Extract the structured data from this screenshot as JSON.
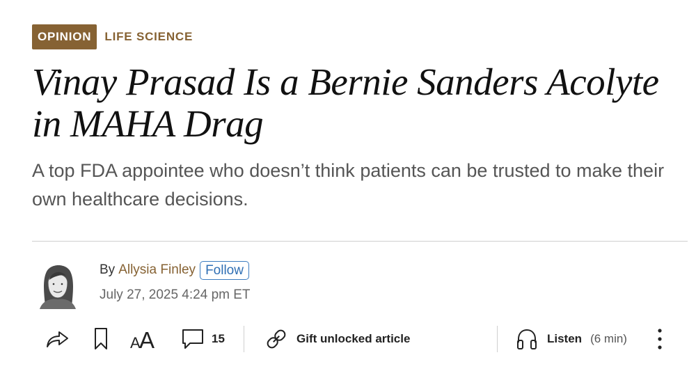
{
  "flags": {
    "opinion": "OPINION",
    "section": "LIFE SCIENCE"
  },
  "article": {
    "headline": "Vinay Prasad Is a Bernie Sanders Acolyte in MAHA Drag",
    "dek": "A top FDA appointee who doesn’t think patients can be trusted to make their own healthcare decisions."
  },
  "byline": {
    "prefix": "By",
    "author": "Allysia Finley",
    "follow_label": "Follow",
    "timestamp": "July 27, 2025 4:24 pm ET"
  },
  "toolbar": {
    "share_icon": "share-icon",
    "bookmark_icon": "bookmark-icon",
    "text_size_icon": "text-size-icon",
    "text_size_glyph": "AA",
    "comments_icon": "comment-icon",
    "comments_count": "15",
    "gift_icon": "link-icon",
    "gift_label": "Gift unlocked article",
    "listen_icon": "headphones-icon",
    "listen_label": "Listen",
    "listen_duration": "(6 min)",
    "more_icon": "more-vertical-icon"
  },
  "colors": {
    "accent_brown": "#866233",
    "follow_blue": "#2f6fb4",
    "rule_gray": "#cfcfcf"
  }
}
